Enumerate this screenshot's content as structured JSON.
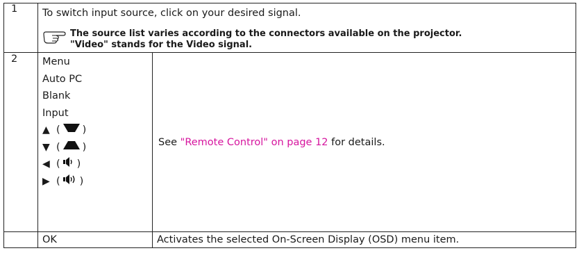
{
  "rows": [
    {
      "number": "1",
      "text": "To switch input source, click on your desired signal.",
      "note": {
        "icon": "hand-pointing-icon",
        "line1": "The source list varies according to the connectors available on the projector.",
        "line2": "\"Video\" stands for the Video signal."
      }
    },
    {
      "number": "2",
      "keys": [
        "Menu",
        "Auto PC",
        "Blank",
        "Input"
      ],
      "arrow_keys": [
        {
          "arrow": "▲",
          "symbol": "keystone-up-icon"
        },
        {
          "arrow": "▼",
          "symbol": "keystone-down-icon"
        },
        {
          "arrow": "◀",
          "symbol": "volume-down-icon"
        },
        {
          "arrow": "▶",
          "symbol": "volume-up-icon"
        }
      ],
      "description_prefix": "See ",
      "description_link": "\"Remote Control\" on page 12",
      "description_suffix": " for details."
    },
    {
      "key": "OK",
      "description": "Activates the selected On-Screen Display (OSD) menu item."
    }
  ],
  "colors": {
    "link": "#d6149e",
    "border": "#222222"
  }
}
